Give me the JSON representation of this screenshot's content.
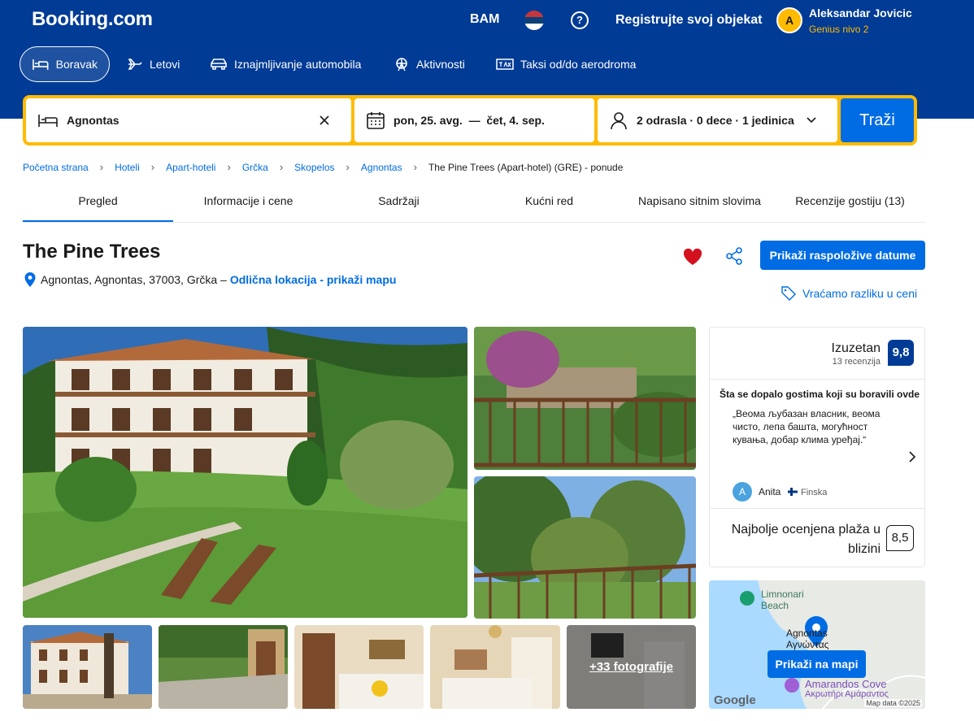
{
  "header": {
    "logo": "Booking.com",
    "currency": "BAM",
    "help": "?",
    "register": "Registrujte svoj objekat",
    "user_initial": "A",
    "user_name": "Aleksandar Jovicic",
    "user_level": "Genius nivo 2"
  },
  "nav": {
    "items": [
      {
        "label": "Boravak",
        "icon": "bed-icon"
      },
      {
        "label": "Letovi",
        "icon": "plane-icon"
      },
      {
        "label": "Iznajmljivanje automobila",
        "icon": "car-icon"
      },
      {
        "label": "Aktivnosti",
        "icon": "ferris-wheel-icon"
      },
      {
        "label": "Taksi od/do aerodroma",
        "icon": "taxi-icon"
      }
    ]
  },
  "search": {
    "destination": "Agnontas",
    "dates": "pon, 25. avg.  —  čet, 4. sep.",
    "guests": "2 odrasla · 0 dece · 1 jedinica",
    "button": "Traži"
  },
  "breadcrumb": [
    "Početna strana",
    "Hoteli",
    "Apart-hoteli",
    "Grčka",
    "Skopelos",
    "Agnontas",
    "The Pine Trees (Apart-hotel) (GRE) - ponude"
  ],
  "tabs": [
    "Pregled",
    "Informacije i cene",
    "Sadržaji",
    "Kućni red",
    "Napisano sitnim slovima",
    "Recenzije gostiju (13)"
  ],
  "property": {
    "name": "The Pine Trees",
    "address": "Agnontas, Agnontas, 37003, Grčka –",
    "location_link": "Odlična lokacija - prikaži mapu",
    "show_dates": "Prikaži raspoložive datume",
    "price_match": "Vraćamo razliku u ceni"
  },
  "photos": {
    "more_label": "+33 fotografije"
  },
  "review": {
    "word": "Izuzetan",
    "count": "13 recenzija",
    "score": "9,8",
    "liked_heading": "Šta se dopalo gostima koji su boravili ovde",
    "quote": "„Веома љубазан власник, веома чисто, лепа башта, могућност кувања, добар клима уређај.“",
    "reviewer_initial": "A",
    "reviewer_name": "Anita",
    "reviewer_country": "Finska",
    "beach_label": "Najbolje ocenjena plaža u blizini",
    "beach_score": "8,5"
  },
  "map": {
    "label_limnonari": "Limnonari Beach",
    "label_agnontas": "Agnontas Αγνώντας",
    "label_cove": "Amarandos Cove",
    "label_cove_gr": "Ακρωτήρι Αμάραντος",
    "button": "Prikaži na mapi",
    "google": "Google",
    "attribution": "Map data ©2025"
  }
}
